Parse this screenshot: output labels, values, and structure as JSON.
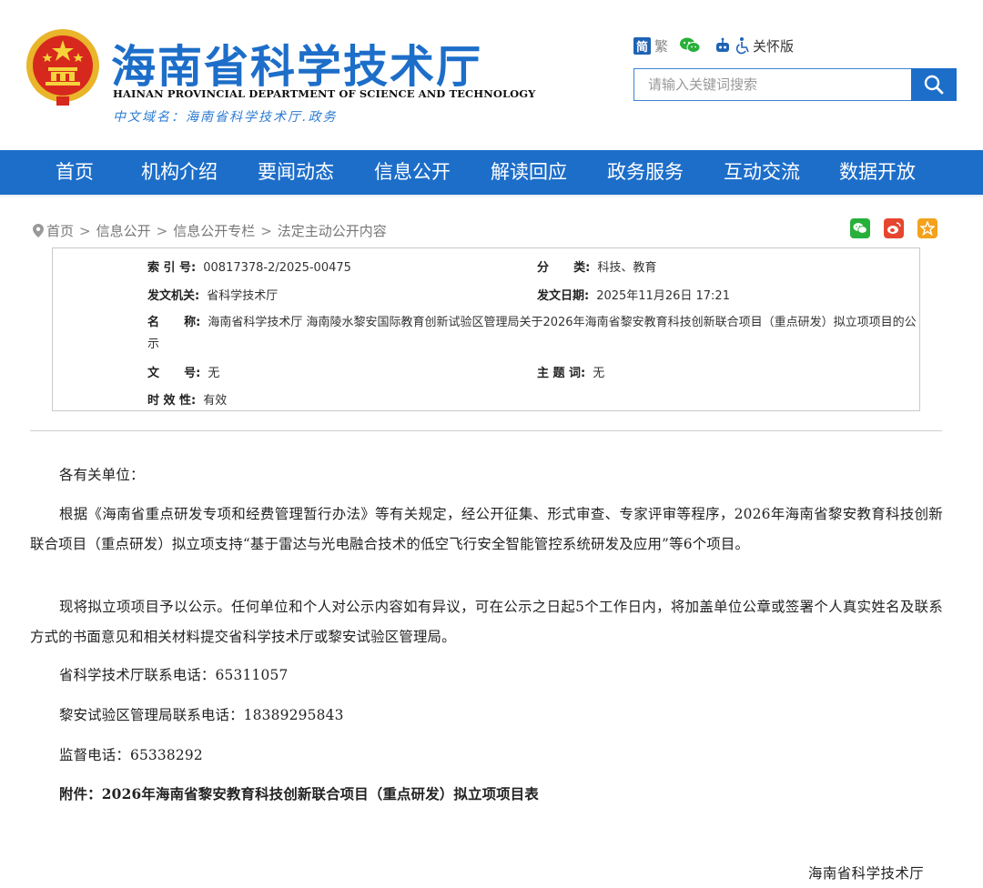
{
  "header": {
    "title": "海南省科学技术厅",
    "title_en": "HAINAN PROVINCIAL DEPARTMENT OF SCIENCE AND TECHNOLOGY",
    "domain_line": "中文域名：海南省科学技术厅.政务",
    "tools": {
      "simplified": "简",
      "traditional": "繁",
      "elder_mode": "关怀版"
    },
    "search": {
      "placeholder": "请输入关键词搜索"
    },
    "colors": {
      "brand": "#1d6ec9",
      "emblem_red": "#d7281e",
      "emblem_gold": "#f2c230"
    }
  },
  "nav": {
    "items": [
      "首页",
      "机构介绍",
      "要闻动态",
      "信息公开",
      "解读回应",
      "政务服务",
      "互动交流",
      "数据开放"
    ]
  },
  "breadcrumb": {
    "items": [
      "首页",
      "信息公开",
      "信息公开专栏",
      "法定主动公开内容"
    ],
    "separator": ">"
  },
  "share": {
    "icons": [
      "wechat-icon",
      "weibo-icon",
      "favorite-icon"
    ],
    "colors": {
      "wechat": "#27b03a",
      "weibo": "#e6452f",
      "favorite": "#f4a11c"
    }
  },
  "meta": {
    "index_label": "索 引 号:",
    "index_value": "00817378-2/2025-00475",
    "category_label": "分      类:",
    "category_value": "科技、教育",
    "issuer_label": "发文机关:",
    "issuer_value": "省科学技术厅",
    "date_label": "发文日期:",
    "date_value": "2025年11月26日 17:21",
    "name_label": "名      称:",
    "name_value": "海南省科学技术厅 海南陵水黎安国际教育创新试验区管理局关于2026年海南省黎安教育科技创新联合项目（重点研发）拟立项项目的公示",
    "doc_no_label": "文      号:",
    "doc_no_value": "无",
    "subject_label": "主 题 词:",
    "subject_value": "无",
    "validity_label": "时 效 性:",
    "validity_value": "有效"
  },
  "article": {
    "greeting": "各有关单位：",
    "p1": "根据《海南省重点研发专项和经费管理暂行办法》等有关规定，经公开征集、形式审查、专家评审等程序，2026年海南省黎安教育科技创新联合项目（重点研发）拟立项支持“基于雷达与光电融合技术的低空飞行安全智能管控系统研发及应用”等6个项目。",
    "p2": "现将拟立项项目予以公示。任何单位和个人对公示内容如有异议，可在公示之日起5个工作日内，将加盖单位公章或签署个人真实姓名及联系方式的书面意见和相关材料提交省科学技术厅或黎安试验区管理局。",
    "contact1": "省科学技术厅联系电话：65311057",
    "contact2": "黎安试验区管理局联系电话：18389295843",
    "contact3": "监督电话：65338292",
    "attachment": "附件：2026年海南省黎安教育科技创新联合项目（重点研发）拟立项项目表",
    "signature": "海南省科学技术厅"
  }
}
